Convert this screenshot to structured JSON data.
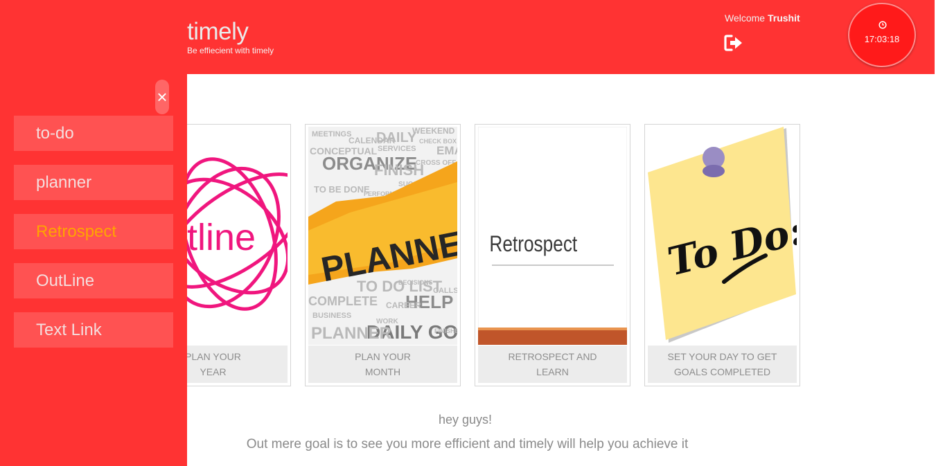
{
  "header": {
    "title": "timely",
    "subtitle": "Be effiecient with timely",
    "welcome_prefix": "Welcome",
    "username": "Trushit",
    "logout_icon": "sign-out-icon",
    "clock_icon": "clock-icon",
    "clock_time": "17:03:18"
  },
  "sidebar": {
    "close_label": "×",
    "items": [
      {
        "label": "to-do",
        "active": false
      },
      {
        "label": "planner",
        "active": false
      },
      {
        "label": "Retrospect",
        "active": true
      },
      {
        "label": "OutLine",
        "active": false
      },
      {
        "label": "Text Link",
        "active": false
      }
    ]
  },
  "cards": [
    {
      "image_text": "tline",
      "caption_line1": "PLAN YOUR",
      "caption_line2": "YEAR"
    },
    {
      "image_text": "PLANNER",
      "caption_line1": "PLAN YOUR",
      "caption_line2": "MONTH",
      "words": [
        "MEETINGS",
        "CALENDAR",
        "DAILY",
        "ORGANIZE",
        "SERVICES",
        "EMAIL",
        "CHECK BOX",
        "FINISH",
        "SUCCESS",
        "TO BE DONE",
        "CROSS OFF",
        "PERFORM",
        "TO DO LIST",
        "DECISIONS",
        "HELP",
        "CAREER",
        "COMPLETE",
        "BUSINESS",
        "DAILY GOALS",
        "PLANNER",
        "CALLS",
        "FINISHED",
        "CONCEPTUAL",
        "WORK",
        "WEEKEND"
      ]
    },
    {
      "image_text": "Retrospect",
      "caption_line1": "RETROSPECT AND",
      "caption_line2": "LEARN"
    },
    {
      "image_text": "To Do:",
      "caption_line1": "SET YOUR DAY TO GET",
      "caption_line2": "GOALS COMPLETED"
    }
  ],
  "message": {
    "greeting": "hey guys!",
    "body": "Out mere goal is to see you more efficient and timely will help you achieve it"
  },
  "colors": {
    "primary": "#ff3333",
    "sidebar_item": "#ff5252",
    "active_item": "#ffa500",
    "outline_pink": "#f0167e",
    "planner_orange": "#f5a51c",
    "sticky_yellow": "#fde68f",
    "retro_bar": "#c0552a"
  }
}
